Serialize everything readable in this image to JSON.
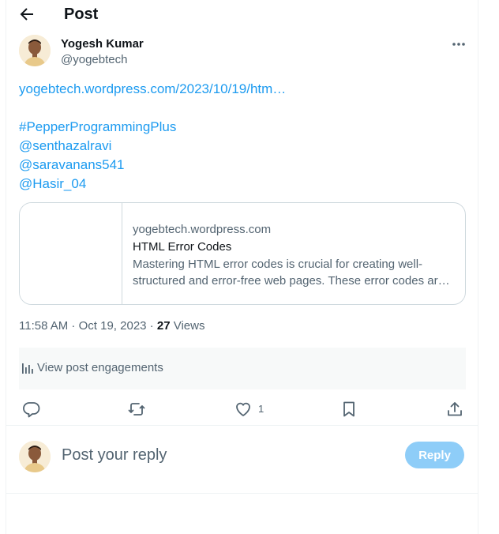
{
  "header": {
    "title": "Post",
    "back_icon": "arrow-left-icon"
  },
  "post": {
    "author": {
      "name": "Yogesh Kumar",
      "handle": "@yogebtech"
    },
    "more_icon": "more-horizontal-icon",
    "link": "yogebtech.wordpress.com/2023/10/19/htm…",
    "hashtag": "#PepperProgrammingPlus",
    "mentions": [
      "@senthazalravi",
      "@saravanans541",
      "@Hasir_04"
    ],
    "card": {
      "domain": "yogebtech.wordpress.com",
      "title": "HTML Error Codes",
      "description": "Mastering HTML error codes is crucial for creating well-structured and error-free web pages. These error codes ar…"
    },
    "time": "11:58 AM",
    "separator": " · ",
    "date": "Oct 19, 2023",
    "views_count": "27",
    "views_label": "Views",
    "engagements_label": "View post engagements",
    "like_count": "1",
    "icons": [
      "reply-icon",
      "repost-icon",
      "like-icon",
      "bookmark-icon",
      "share-icon"
    ]
  },
  "reply": {
    "placeholder": "Post your reply",
    "button_label": "Reply"
  },
  "colors": {
    "link": "#1d9bf0",
    "muted": "#536471",
    "text": "#0f1419",
    "reply_button": "#8ecdf8",
    "border": "#cfd9de"
  }
}
